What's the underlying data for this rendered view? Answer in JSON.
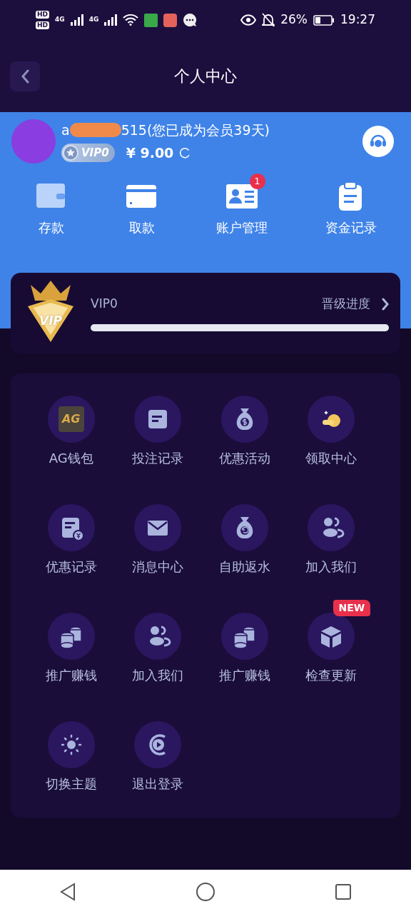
{
  "status_bar": {
    "sim_labels": [
      "HD",
      "HD"
    ],
    "network_labels": [
      "4G",
      "4G"
    ],
    "battery_percent": "26%",
    "time": "19:27"
  },
  "header": {
    "title": "个人中心"
  },
  "profile": {
    "name_start": "a",
    "name_end": "515(您已成为会员39天)",
    "vip_badge": "VIP0",
    "balance": "¥ 9.00"
  },
  "quick_actions": [
    {
      "label": "存款",
      "kind": "wallet"
    },
    {
      "label": "取款",
      "kind": "card"
    },
    {
      "label": "账户管理",
      "kind": "idcard",
      "badge": "1"
    },
    {
      "label": "资金记录",
      "kind": "clipboard"
    }
  ],
  "vip_card": {
    "emblem_text": "VIP",
    "level_name": "VIP0",
    "progress_label": "晋级进度",
    "level": 0
  },
  "menu": [
    {
      "label": "AG钱包",
      "kind": "ag",
      "logo_text": "AG"
    },
    {
      "label": "投注记录",
      "kind": "note"
    },
    {
      "label": "优惠活动",
      "kind": "moneybag"
    },
    {
      "label": "领取中心",
      "kind": "coins"
    },
    {
      "label": "优惠记录",
      "kind": "receipt"
    },
    {
      "label": "消息中心",
      "kind": "mail"
    },
    {
      "label": "自助返水",
      "kind": "returnbag"
    },
    {
      "label": "加入我们",
      "kind": "people"
    },
    {
      "label": "推广赚钱",
      "kind": "stack"
    },
    {
      "label": "加入我们",
      "kind": "people"
    },
    {
      "label": "推广赚钱",
      "kind": "stack"
    },
    {
      "label": "检查更新",
      "kind": "cube",
      "badge": "NEW"
    },
    {
      "label": "切换主题",
      "kind": "sun"
    },
    {
      "label": "退出登录",
      "kind": "logout"
    }
  ]
}
